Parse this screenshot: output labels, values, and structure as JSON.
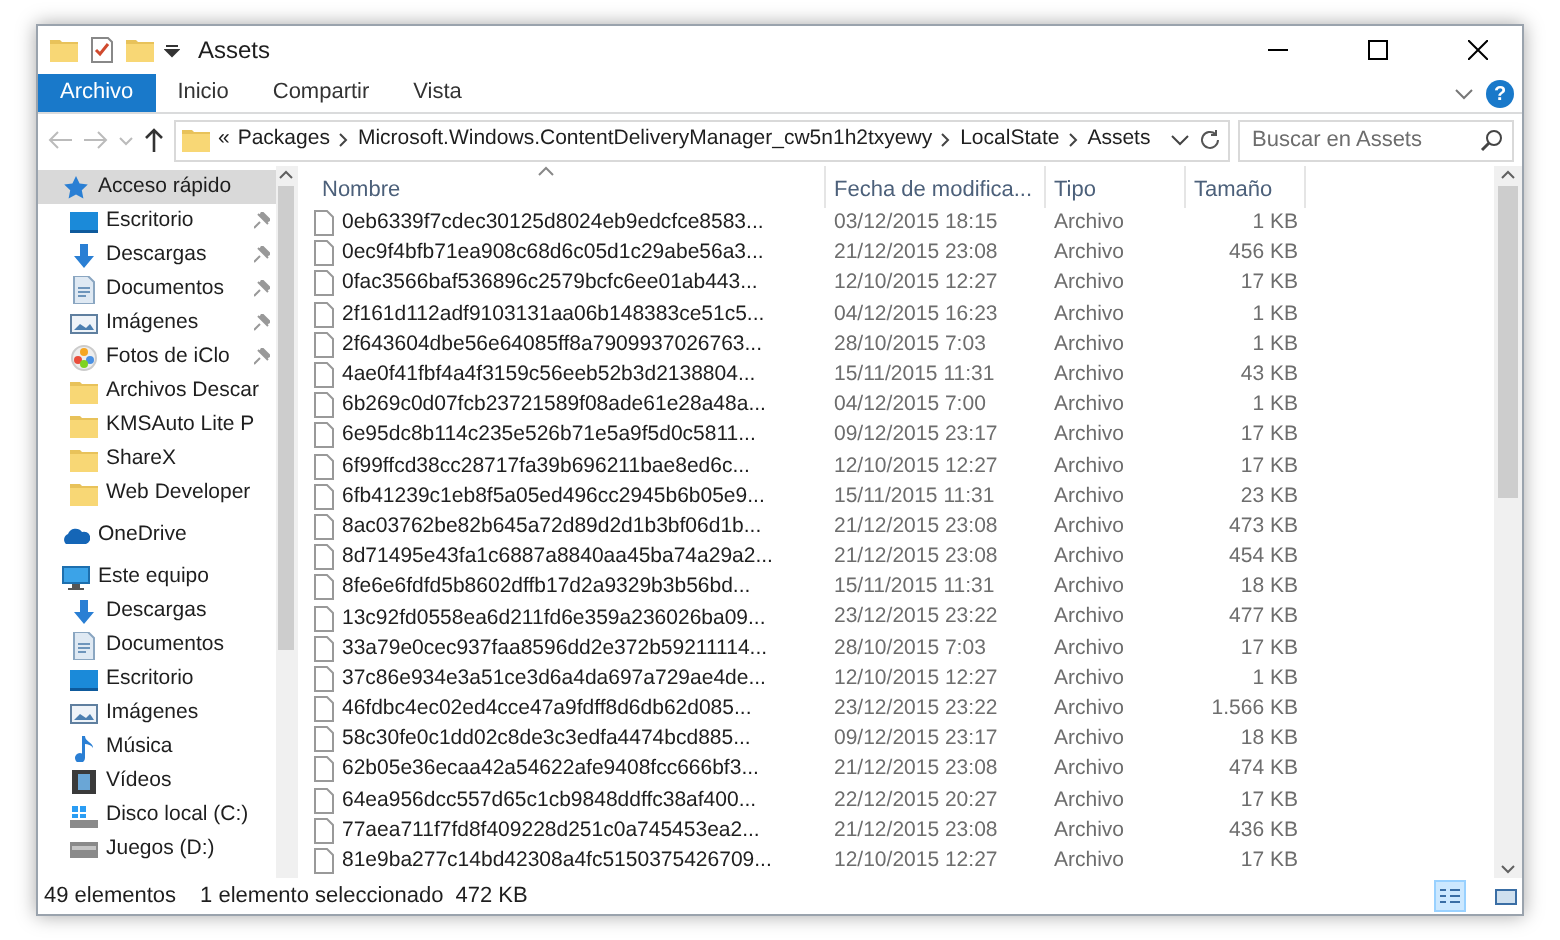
{
  "window": {
    "title": "Assets"
  },
  "ribbon": {
    "tabs": [
      {
        "label": "Archivo",
        "selected": true
      },
      {
        "label": "Inicio",
        "selected": false
      },
      {
        "label": "Compartir",
        "selected": false
      },
      {
        "label": "Vista",
        "selected": false
      }
    ],
    "help": "?"
  },
  "address": {
    "overflow": "«",
    "path": [
      "Packages",
      "Microsoft.Windows.ContentDeliveryManager_cw5n1h2txyewy",
      "LocalState",
      "Assets"
    ]
  },
  "search": {
    "placeholder": "Buscar en Assets"
  },
  "navigation": [
    {
      "label": "Acceso rápido",
      "kind": "star",
      "selected": true,
      "children": [
        {
          "label": "Escritorio",
          "kind": "desktop",
          "pinned": true
        },
        {
          "label": "Descargas",
          "kind": "download",
          "pinned": true
        },
        {
          "label": "Documentos",
          "kind": "document",
          "pinned": true
        },
        {
          "label": "Imágenes",
          "kind": "image",
          "pinned": true
        },
        {
          "label": "Fotos de iClo",
          "kind": "photos",
          "pinned": true
        },
        {
          "label": "Archivos Descar",
          "kind": "folder",
          "pinned": false
        },
        {
          "label": "KMSAuto Lite P",
          "kind": "folder",
          "pinned": false
        },
        {
          "label": "ShareX",
          "kind": "folder",
          "pinned": false
        },
        {
          "label": "Web Developer",
          "kind": "folder",
          "pinned": false
        }
      ]
    },
    {
      "label": "OneDrive",
      "kind": "cloud",
      "selected": false
    },
    {
      "label": "Este equipo",
      "kind": "pc",
      "selected": false,
      "children": [
        {
          "label": "Descargas",
          "kind": "download",
          "pinned": false
        },
        {
          "label": "Documentos",
          "kind": "document",
          "pinned": false
        },
        {
          "label": "Escritorio",
          "kind": "desktop",
          "pinned": false
        },
        {
          "label": "Imágenes",
          "kind": "image",
          "pinned": false
        },
        {
          "label": "Música",
          "kind": "music",
          "pinned": false
        },
        {
          "label": "Vídeos",
          "kind": "video",
          "pinned": false
        },
        {
          "label": "Disco local (C:)",
          "kind": "system-drive",
          "pinned": false
        },
        {
          "label": "Juegos (D:)",
          "kind": "drive",
          "pinned": false
        }
      ]
    }
  ],
  "columns": [
    {
      "label": "Nombre",
      "sorted": true
    },
    {
      "label": "Fecha de modifica...",
      "sorted": false
    },
    {
      "label": "Tipo",
      "sorted": false
    },
    {
      "label": "Tamaño",
      "sorted": false
    }
  ],
  "files": [
    {
      "name": "0eb6339f7cdec30125d8024eb9edcfce8583...",
      "modified": "03/12/2015 18:15",
      "type": "Archivo",
      "size": "1 KB"
    },
    {
      "name": "0ec9f4bfb71ea908c68d6c05d1c29abe56a3...",
      "modified": "21/12/2015 23:08",
      "type": "Archivo",
      "size": "456 KB"
    },
    {
      "name": "0fac3566baf536896c2579bcfc6ee01ab443...",
      "modified": "12/10/2015 12:27",
      "type": "Archivo",
      "size": "17 KB"
    },
    {
      "name": "2f161d112adf9103131aa06b148383ce51c5...",
      "modified": "04/12/2015 16:23",
      "type": "Archivo",
      "size": "1 KB"
    },
    {
      "name": "2f643604dbe56e64085ff8a7909937026763...",
      "modified": "28/10/2015 7:03",
      "type": "Archivo",
      "size": "1 KB"
    },
    {
      "name": "4ae0f41fbf4a4f3159c56eeb52b3d2138804...",
      "modified": "15/11/2015 11:31",
      "type": "Archivo",
      "size": "43 KB"
    },
    {
      "name": "6b269c0d07fcb23721589f08ade61e28a48a...",
      "modified": "04/12/2015 7:00",
      "type": "Archivo",
      "size": "1 KB"
    },
    {
      "name": "6e95dc8b114c235e526b71e5a9f5d0c5811...",
      "modified": "09/12/2015 23:17",
      "type": "Archivo",
      "size": "17 KB"
    },
    {
      "name": "6f99ffcd38cc28717fa39b696211bae8ed6c...",
      "modified": "12/10/2015 12:27",
      "type": "Archivo",
      "size": "17 KB"
    },
    {
      "name": "6fb41239c1eb8f5a05ed496cc2945b6b05e9...",
      "modified": "15/11/2015 11:31",
      "type": "Archivo",
      "size": "23 KB"
    },
    {
      "name": "8ac03762be82b645a72d89d2d1b3bf06d1b...",
      "modified": "21/12/2015 23:08",
      "type": "Archivo",
      "size": "473 KB"
    },
    {
      "name": "8d71495e43fa1c6887a8840aa45ba74a29a2...",
      "modified": "21/12/2015 23:08",
      "type": "Archivo",
      "size": "454 KB"
    },
    {
      "name": "8fe6e6fdfd5b8602dffb17d2a9329b3b56bd...",
      "modified": "15/11/2015 11:31",
      "type": "Archivo",
      "size": "18 KB"
    },
    {
      "name": "13c92fd0558ea6d211fd6e359a236026ba09...",
      "modified": "23/12/2015 23:22",
      "type": "Archivo",
      "size": "477 KB"
    },
    {
      "name": "33a79e0cec937faa8596dd2e372b59211114...",
      "modified": "28/10/2015 7:03",
      "type": "Archivo",
      "size": "17 KB"
    },
    {
      "name": "37c86e934e3a51ce3d6a4da697a729ae4de...",
      "modified": "12/10/2015 12:27",
      "type": "Archivo",
      "size": "1 KB"
    },
    {
      "name": "46fdbc4ec02ed4cce47a9fdff8d6db62d085...",
      "modified": "23/12/2015 23:22",
      "type": "Archivo",
      "size": "1.566 KB"
    },
    {
      "name": "58c30fe0c1dd02c8de3c3edfa4474bcd885...",
      "modified": "09/12/2015 23:17",
      "type": "Archivo",
      "size": "18 KB"
    },
    {
      "name": "62b05e36ecaa42a54622afe9408fcc666bf3...",
      "modified": "21/12/2015 23:08",
      "type": "Archivo",
      "size": "474 KB"
    },
    {
      "name": "64ea956dcc557d65c1cb9848ddffc38af400...",
      "modified": "22/12/2015 20:27",
      "type": "Archivo",
      "size": "17 KB"
    },
    {
      "name": "77aea711f7fd8f409228d251c0a745453ea2...",
      "modified": "21/12/2015 23:08",
      "type": "Archivo",
      "size": "436 KB"
    },
    {
      "name": "81e9ba277c14bd42308a4fc5150375426709...",
      "modified": "12/10/2015 12:27",
      "type": "Archivo",
      "size": "17 KB"
    }
  ],
  "status_bar": {
    "item_count": "49 elementos",
    "selection": "1 elemento seleccionado",
    "selection_size": "472 KB"
  },
  "view_buttons": [
    {
      "kind": "details",
      "selected": true
    },
    {
      "kind": "large-icons",
      "selected": false
    }
  ]
}
